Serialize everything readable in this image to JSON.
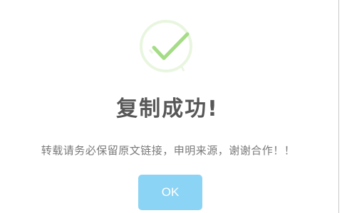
{
  "dialog": {
    "icon": "success-check-icon",
    "title": "复制成功!",
    "message": "转载请务必保留原文链接，申明来源，谢谢合作！！",
    "confirm_label": "OK"
  },
  "colors": {
    "check_stroke": "#a5dc86",
    "ring_stroke": "#e9f6df",
    "title_text": "#575757",
    "message_text": "#797979",
    "button_bg": "#8cd4f5",
    "button_text": "#ffffff"
  }
}
